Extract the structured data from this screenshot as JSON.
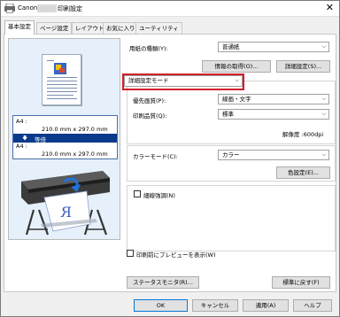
{
  "window": {
    "title_prefix": "Canon",
    "title_suffix": "印刷設定",
    "close_glyph": "✕"
  },
  "tabs": [
    {
      "label": "基本設定"
    },
    {
      "label": "ページ設定"
    },
    {
      "label": "レイアウト"
    },
    {
      "label": "お気に入り"
    },
    {
      "label": "ユーティリティ"
    }
  ],
  "preview": {
    "src_size_label": "A4 :",
    "src_size_value": "210.0 mm x 297.0 mm",
    "scale_arrow": "🡇",
    "scale_label": "等倍",
    "dst_size_label": "A4 :",
    "dst_size_value": "210.0 mm x 297.0 mm"
  },
  "form": {
    "media_type_label": "用紙の種類(Y):",
    "media_type_value": "普通紙",
    "get_info_button": "情報の取得(O)...",
    "advanced_button": "詳細設定(S)...",
    "mode_combo_value": "詳細設定モード",
    "priority_label": "優先画質(P):",
    "priority_value": "線画・文字",
    "print_quality_label": "印刷品質(Q):",
    "print_quality_value": "標準",
    "resolution_text": "解像度 :600dpi",
    "color_mode_label": "カラーモード(C):",
    "color_mode_value": "カラー",
    "color_settings_button": "色設定(E)...",
    "fine_gradation_label": "細線強調(N)",
    "preview_before_print_label": "印刷前にプレビューを表示(W)",
    "status_monitor_button": "ステータスモニタ(R)...",
    "defaults_button": "標準に戻す(F)"
  },
  "dialog_buttons": {
    "ok": "OK",
    "cancel": "キャンセル",
    "apply": "適用(A)",
    "help": "ヘルプ"
  },
  "colors": {
    "highlight_box": "#d21f2a",
    "size_selected_bg": "#0a3a8c",
    "preview_bg": "#e6f0fb",
    "ok_border": "#0078d7"
  },
  "icons": {
    "printer_app": "printer-app-icon",
    "dropdown": "chevron-down-icon"
  }
}
